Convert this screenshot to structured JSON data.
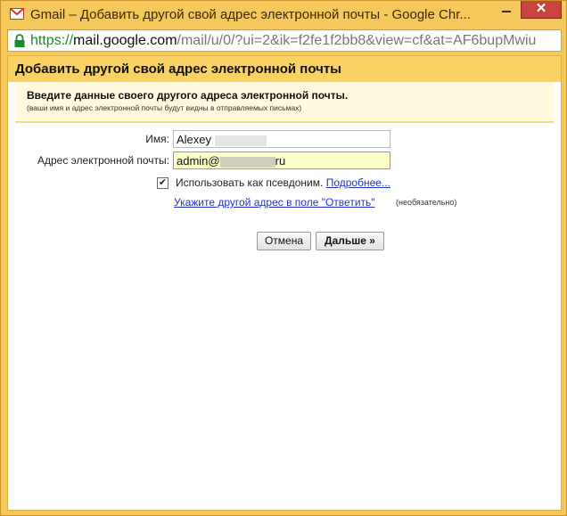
{
  "window": {
    "title": "Gmail – Добавить другой свой адрес электронной почты - Google Chr...",
    "close_glyph": "✕"
  },
  "address_bar": {
    "scheme": "https://",
    "host": "mail.google.com",
    "path": "/mail/u/0/?ui=2&ik=f2fe1f2bb8&view=cf&at=AF6bupMwiu"
  },
  "dialog": {
    "title": "Добавить другой свой адрес электронной почты",
    "instruction": "Введите данные своего другого адреса электронной почты.",
    "instruction_note": "(ваши имя и адрес электронной почты будут видны в отправляемых письмах)",
    "form": {
      "name_label": "Имя:",
      "name_value": "Alexey",
      "email_label": "Адрес электронной почты:",
      "email_value_prefix": "admin@",
      "email_value_suffix": "ru",
      "alias_checkbox_checked": true,
      "alias_label": "Использовать как псевдоним.",
      "learn_more_link": "Подробнее...",
      "reply_to_link": "Укажите другой адрес в поле \"Ответить\"",
      "optional_note": "(необязательно)"
    },
    "buttons": {
      "cancel": "Отмена",
      "next": "Дальше »"
    }
  },
  "colors": {
    "window_frame": "#f4c85a",
    "header_bg": "#fad163",
    "info_bg": "#fff9dd",
    "email_field_bg": "#fdfdc8",
    "link": "#2233cc",
    "close_button": "#c7453a"
  }
}
